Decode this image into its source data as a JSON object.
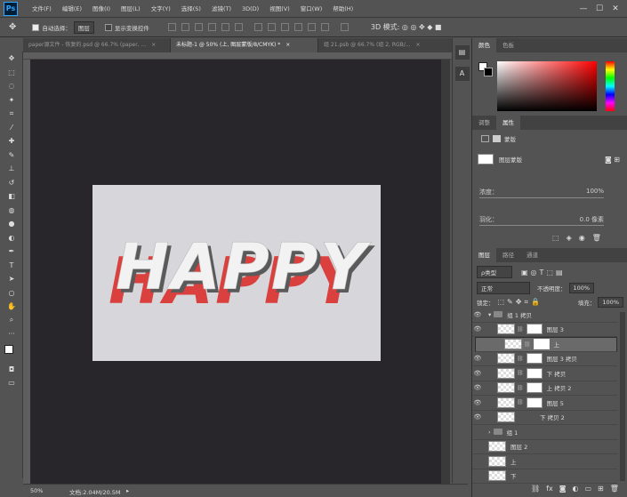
{
  "app": {
    "logo": "Ps"
  },
  "menu": [
    "文件(F)",
    "编辑(E)",
    "图像(I)",
    "图层(L)",
    "文字(Y)",
    "选择(S)",
    "滤镜(T)",
    "3D(D)",
    "视图(V)",
    "窗口(W)",
    "帮助(H)"
  ],
  "window_controls": {
    "minimize": "—",
    "maximize": "☐",
    "close": "✕"
  },
  "options": {
    "auto_select_label": "自动选择：",
    "auto_select_value": "图层",
    "transform_label": "显示变换控件"
  },
  "tabs": [
    {
      "label": "paper源文件 - 恢复的.psd @ 66.7% (paper, ...",
      "close": "×"
    },
    {
      "label": "未标题-1 @ 50% (上, 图层蒙版/8/CMYK) *",
      "close": "×"
    },
    {
      "label": "组 21.psb @ 66.7% (组 2, RGB/...",
      "close": "×"
    }
  ],
  "canvas": {
    "text": "HAPPY",
    "shadow_color": "#d9403e",
    "text_color": "#f2f2f2"
  },
  "status": {
    "zoom": "50%",
    "doc": "文档:2.04M/20.5M"
  },
  "color_panel": {
    "tabs": [
      "颜色",
      "色板"
    ]
  },
  "properties_panel": {
    "tabs": [
      "调整",
      "属性"
    ],
    "mode": "蒙版",
    "layer_mask_label": "图层蒙版",
    "density_label": "浓度：",
    "density_value": "100%",
    "feather_label": "羽化：",
    "feather_value": "0.0 像素"
  },
  "layers_panel": {
    "tabs": [
      "图层",
      "路径",
      "通道"
    ],
    "filter_label": "ρ类型",
    "blend_mode": "正常",
    "opacity_label": "不透明度：",
    "opacity_value": "100%",
    "lock_label": "锁定：",
    "fill_label": "填充：",
    "fill_value": "100%",
    "layers": [
      {
        "name": "组 1 拷贝",
        "type": "group",
        "visible": true
      },
      {
        "name": "图层 3",
        "type": "layer",
        "visible": true
      },
      {
        "name": "上",
        "type": "layer",
        "visible": false,
        "selected": true
      },
      {
        "name": "图层 3 拷贝",
        "type": "layer",
        "visible": true
      },
      {
        "name": "下 拷贝",
        "type": "layer",
        "visible": true
      },
      {
        "name": "上 拷贝 2",
        "type": "layer",
        "visible": true
      },
      {
        "name": "图层 5",
        "type": "layer",
        "visible": true
      },
      {
        "name": "下 拷贝 2",
        "type": "layer",
        "visible": true
      },
      {
        "name": "组 1",
        "type": "group",
        "visible": false
      },
      {
        "name": "图层 2",
        "type": "layer",
        "visible": false
      },
      {
        "name": "上",
        "type": "layer",
        "visible": false
      },
      {
        "name": "下",
        "type": "layer",
        "visible": false
      }
    ]
  }
}
